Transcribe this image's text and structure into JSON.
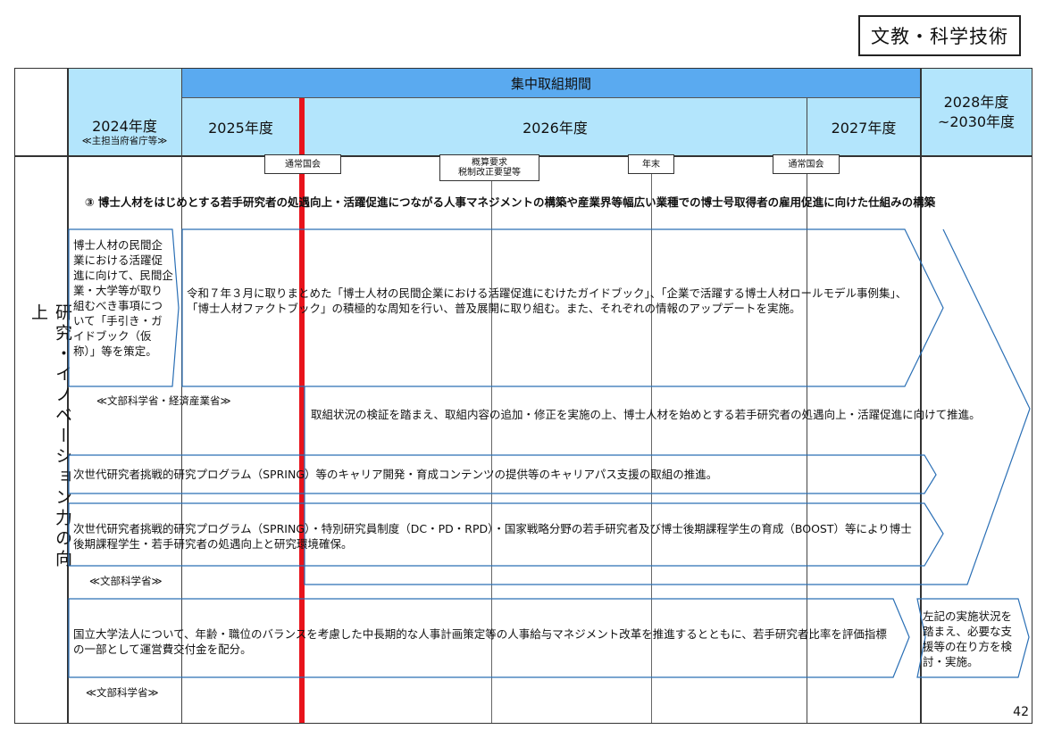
{
  "category": "文教・科学技術",
  "page_number": "42",
  "row_label": "研究・イノベーション力の向上",
  "header": {
    "period": "集中取組期間",
    "y2024": "2024年度",
    "y2024_sub": "≪主担当府省庁等≫",
    "y2025": "2025年度",
    "y2026": "2026年度",
    "y2027": "2027年度",
    "y2028_line1": "2028年度",
    "y2028_line2": "~2030年度"
  },
  "milestones": [
    {
      "label": "通常国会"
    },
    {
      "label": "概算要求\n税制改正要望等"
    },
    {
      "label": "年末"
    },
    {
      "label": "通常国会"
    }
  ],
  "heading": "③ 博士人材をはじめとする若手研究者の処遇向上・活躍促進につながる人事マネジメントの構築や産業界等幅広い業種での博士号取得者の雇用促進に向けた仕組みの構築",
  "blocks": {
    "a_left": "博士人材の民間企業における活躍促進に向けて、民間企業・大学等が取り組むべき事項について「手引き・ガイドブック（仮称）」等を策定。",
    "a_main": "令和７年３月に取りまとめた「博士人材の民間企業における活躍促進にむけたガイドブック」、「企業で活躍する博士人材ロールモデル事例集」、「博士人材ファクトブック」の積極的な周知を行い、普及展開に取り組む。また、それぞれの情報のアップデートを実施。",
    "a_ministry": "≪文部科学省・経済産業省≫",
    "a_follow": "取組状況の検証を踏まえ、取組内容の追加・修正を実施の上、博士人材を始めとする若手研究者の処遇向上・活躍促進に向けて推進。",
    "b_text": "次世代研究者挑戦的研究プログラム（SPRING）等のキャリア開発・育成コンテンツの提供等のキャリアパス支援の取組の推進。",
    "c_text": "次世代研究者挑戦的研究プログラム（SPRING）・特別研究員制度（DC・PD・RPD）・国家戦略分野の若手研究者及び博士後期課程学生の育成（BOOST）等により博士後期課程学生・若手研究者の処遇向上と研究環境確保。",
    "c_ministry": "≪文部科学省≫",
    "d_text": "国立大学法人について、年齢・職位のバランスを考慮した中長期的な人事計画策定等の人事給与マネジメント改革を推進するとともに、若手研究者比率を評価指標の一部として運営費交付金を配分。",
    "d_ministry": "≪文部科学省≫",
    "d_right": "左記の実施状況を踏まえ、必要な支援等の在り方を検討・実施。"
  },
  "colors": {
    "header_light": "#b3e5fc",
    "header_dark": "#5aaaf0",
    "arrow_stroke": "#2a6fb5",
    "today_line": "#e8131b"
  }
}
